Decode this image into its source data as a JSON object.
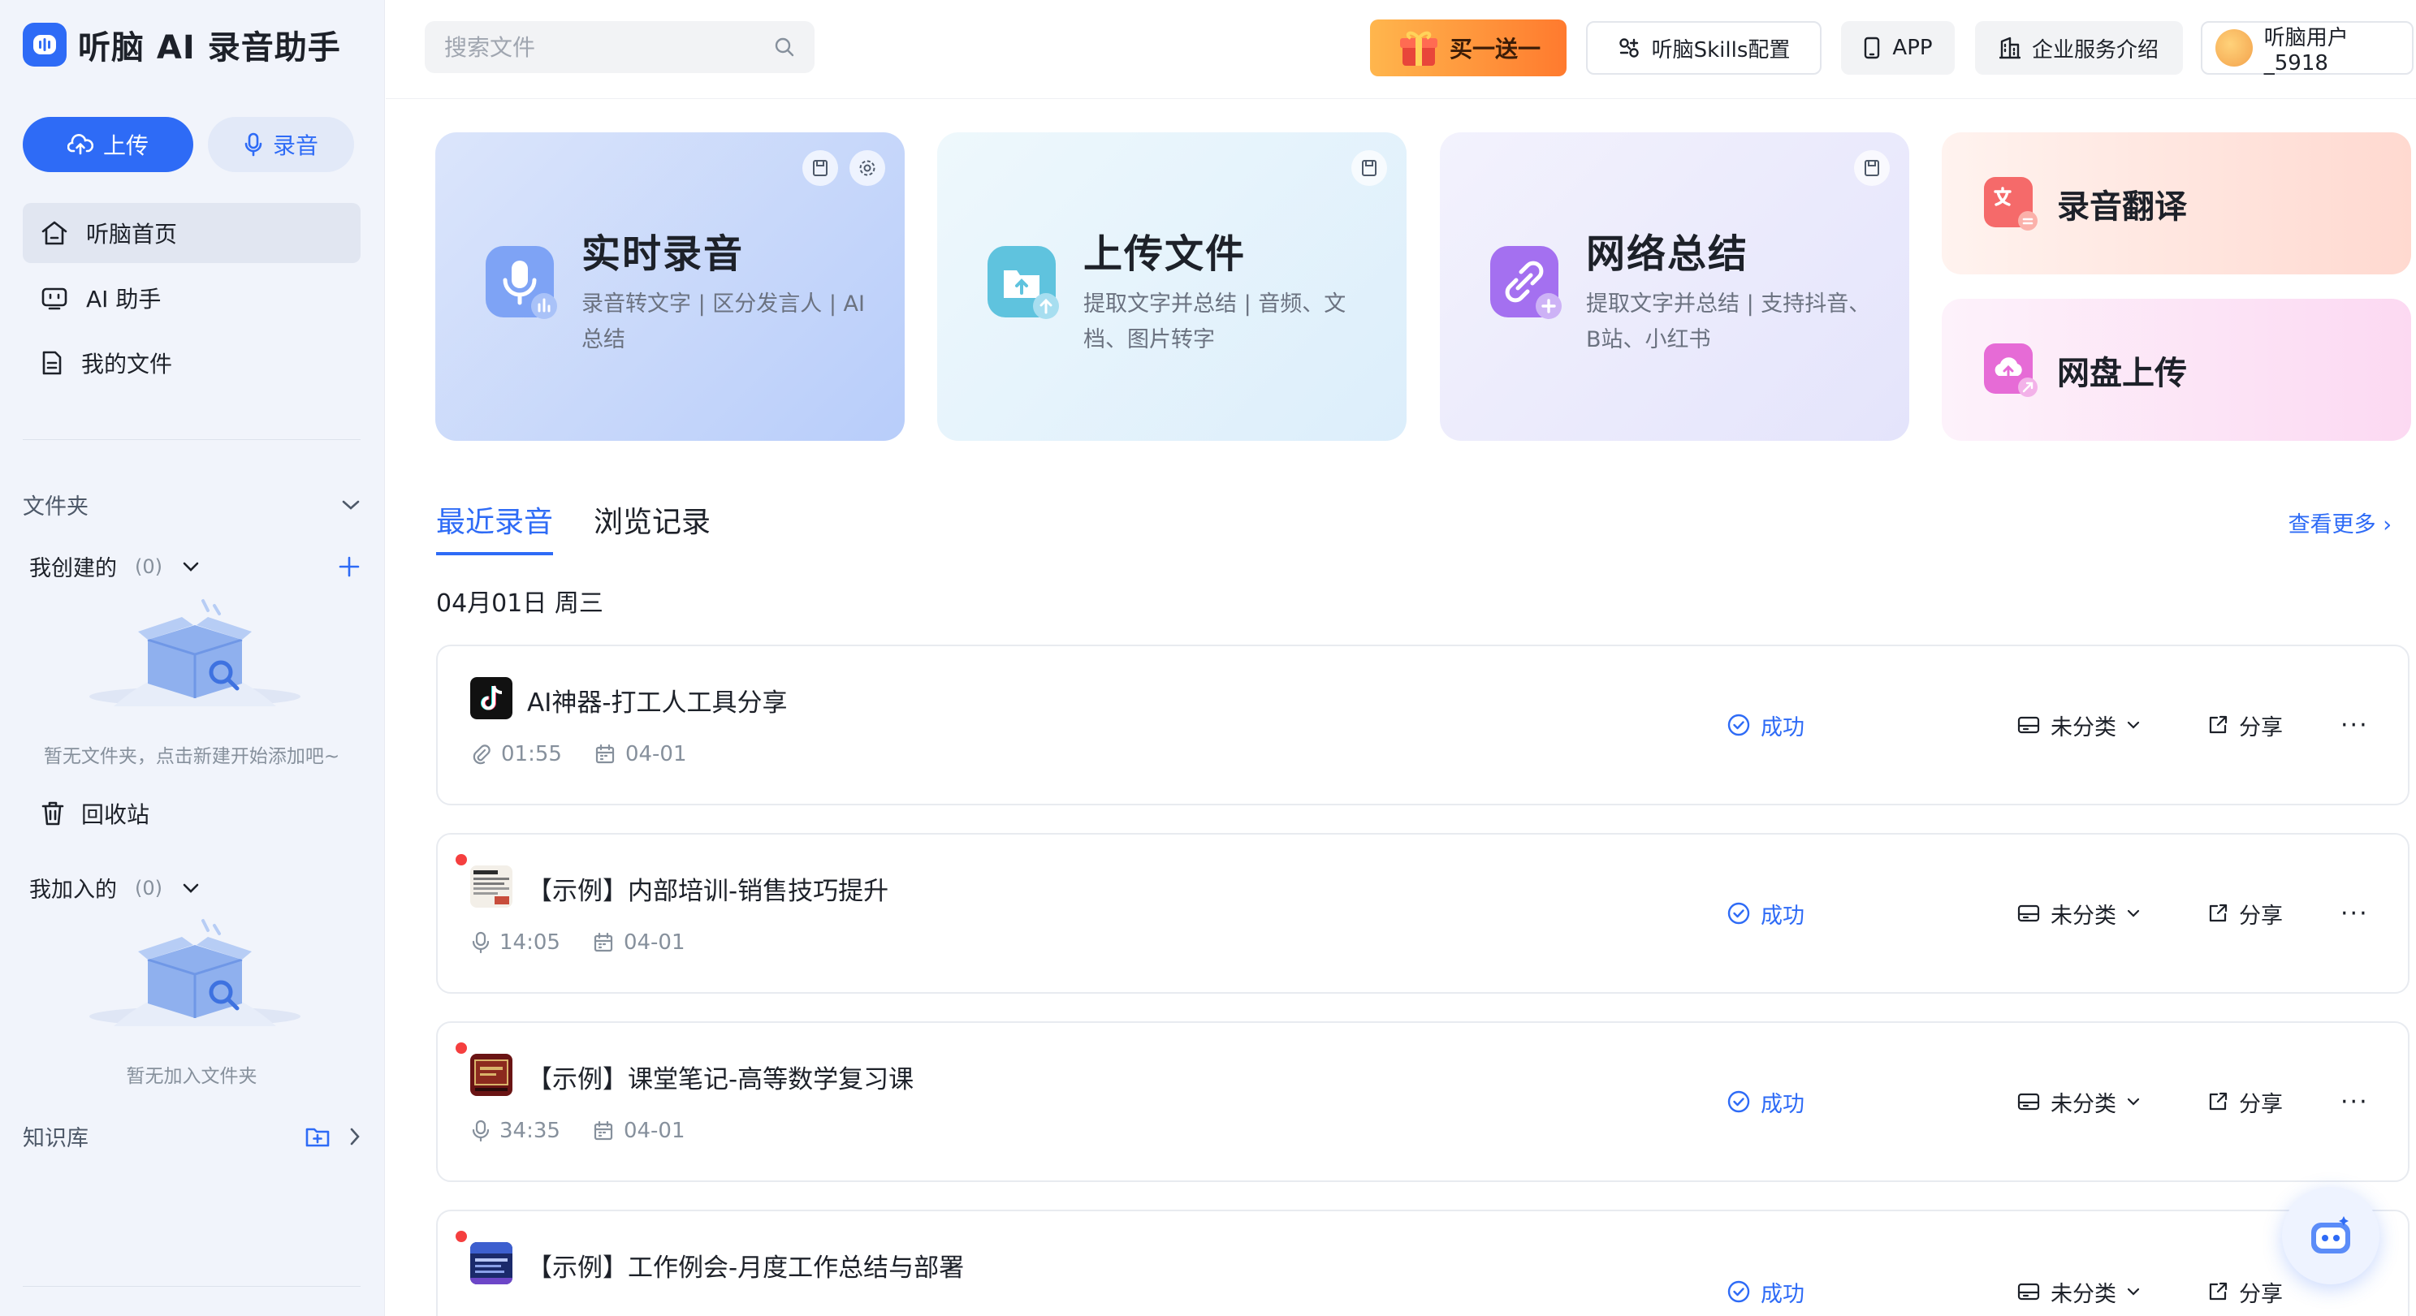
{
  "app": {
    "title": "听脑 AI 录音助手"
  },
  "sidebar": {
    "upload_label": "上传",
    "record_label": "录音",
    "nav": [
      {
        "label": "听脑首页",
        "icon": "home-icon",
        "active": true
      },
      {
        "label": "AI 助手",
        "icon": "robot-icon",
        "active": false
      },
      {
        "label": "我的文件",
        "icon": "file-icon",
        "active": false
      }
    ],
    "folders_label": "文件夹",
    "created": {
      "label": "我创建的",
      "count": "(0)",
      "empty_text": "暂无文件夹，点击新建开始添加吧~"
    },
    "recycle_label": "回收站",
    "joined": {
      "label": "我加入的",
      "count": "(0)",
      "empty_text": "暂无加入文件夹"
    },
    "knowledge_label": "知识库"
  },
  "topbar": {
    "search_placeholder": "搜索文件",
    "promo_label": "买一送一",
    "skills_label": "听脑Skills配置",
    "app_label": "APP",
    "enterprise_label": "企业服务介绍",
    "user_name": "听脑用户_5918"
  },
  "features": [
    {
      "title": "实时录音",
      "desc": "录音转文字 | 区分发言人 | AI总结",
      "icon": "microphone-icon"
    },
    {
      "title": "上传文件",
      "desc": "提取文字并总结 | 音频、文档、图片转字",
      "icon": "upload-folder-icon"
    },
    {
      "title": "网络总结",
      "desc": "提取文字并总结 | 支持抖音、B站、小红书",
      "icon": "link-icon"
    },
    {
      "title": "录音翻译",
      "icon": "translate-icon"
    },
    {
      "title": "网盘上传",
      "icon": "cloud-upload-icon"
    }
  ],
  "tabs": {
    "recent": "最近录音",
    "history": "浏览记录",
    "see_more": "查看更多 ›"
  },
  "date_group": "04月01日 周三",
  "files": [
    {
      "name": "AI神器-打工人工具分享",
      "duration": "01:55",
      "date": "04-01",
      "status": "成功",
      "category": "未分类",
      "share": "分享",
      "source": "link",
      "unread": false
    },
    {
      "name": "【示例】内部培训-销售技巧提升",
      "duration": "14:05",
      "date": "04-01",
      "status": "成功",
      "category": "未分类",
      "share": "分享",
      "source": "mic",
      "unread": true
    },
    {
      "name": "【示例】课堂笔记-高等数学复习课",
      "duration": "34:35",
      "date": "04-01",
      "status": "成功",
      "category": "未分类",
      "share": "分享",
      "source": "mic",
      "unread": true
    },
    {
      "name": "【示例】工作例会-月度工作总结与部署",
      "duration": "",
      "date": "",
      "status": "成功",
      "category": "未分类",
      "share": "分享",
      "source": "mic",
      "unread": true
    }
  ],
  "colors": {
    "accent": "#2e6bf6",
    "sidebar_bg": "#f1f4fb",
    "danger_dot": "#f53f3f"
  }
}
